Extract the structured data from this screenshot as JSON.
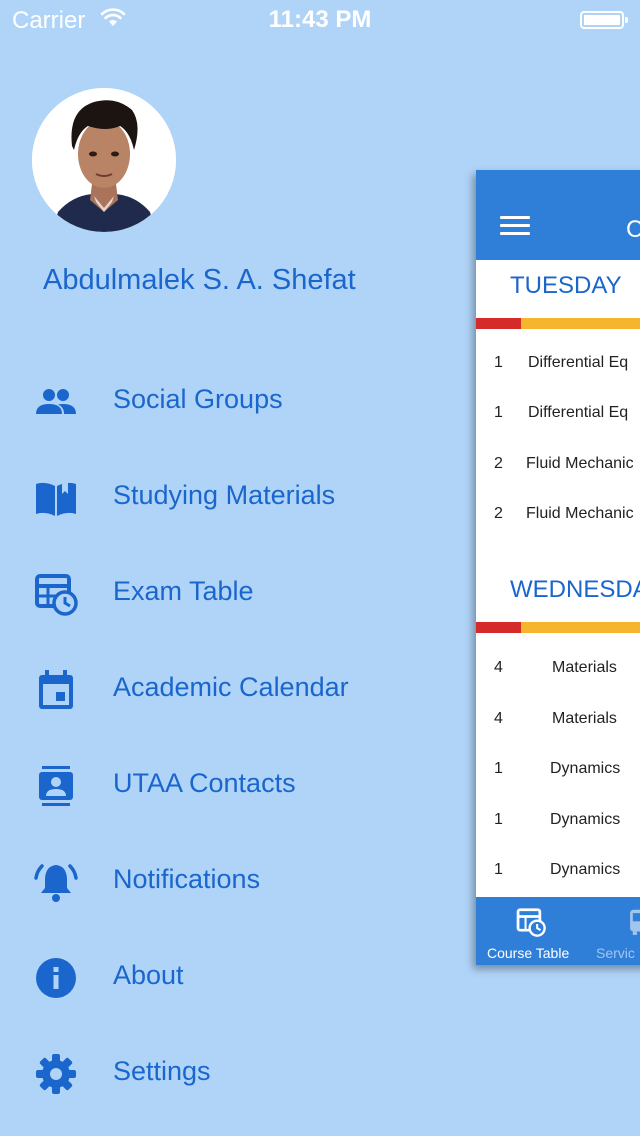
{
  "status_bar": {
    "carrier": "Carrier",
    "time": "11:43 PM"
  },
  "drawer": {
    "user_name": "Abdulmalek S. A. Shefat",
    "items": [
      {
        "label": "Social Groups",
        "icon": "group-icon"
      },
      {
        "label": "Studying Materials",
        "icon": "book-icon"
      },
      {
        "label": "Exam Table",
        "icon": "table-clock-icon"
      },
      {
        "label": "Academic Calendar",
        "icon": "calendar-icon"
      },
      {
        "label": "UTAA Contacts",
        "icon": "contact-card-icon"
      },
      {
        "label": "Notifications",
        "icon": "bell-icon"
      },
      {
        "label": "About",
        "icon": "info-icon"
      },
      {
        "label": "Settings",
        "icon": "gear-icon"
      }
    ]
  },
  "main": {
    "title_initial": "C",
    "days": [
      {
        "name": "TUESDAY",
        "rows": [
          {
            "num": "1",
            "course": "Differential Eq"
          },
          {
            "num": "1",
            "course": "Differential Eq"
          },
          {
            "num": "2",
            "course": "Fluid Mechanic"
          },
          {
            "num": "2",
            "course": "Fluid Mechanic"
          }
        ]
      },
      {
        "name": "WEDNESDAY",
        "rows": [
          {
            "num": "4",
            "course": "Materials"
          },
          {
            "num": "4",
            "course": "Materials"
          },
          {
            "num": "1",
            "course": "Dynamics"
          },
          {
            "num": "1",
            "course": "Dynamics"
          },
          {
            "num": "1",
            "course": "Dynamics"
          }
        ]
      }
    ],
    "tabs": [
      {
        "label": "Course Table"
      },
      {
        "label": "Servic"
      }
    ]
  },
  "colors": {
    "drawer_background": "#b0d4f8",
    "accent": "#1a66cc",
    "app_bar": "#2f7fd9",
    "day_bar_red": "#d42a2a",
    "day_bar_yellow": "#f5b52e"
  }
}
